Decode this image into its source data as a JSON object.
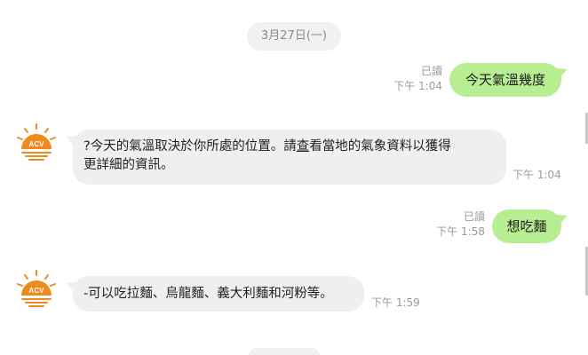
{
  "date_separator": "3月27日(一)",
  "brand": {
    "avatar_text": "ACV",
    "avatar_color": "#f08a1e"
  },
  "colors": {
    "outgoing_bubble": "#b8ee92",
    "incoming_bubble": "#efefef"
  },
  "messages": [
    {
      "direction": "out",
      "text": "今天氣溫幾度",
      "read": "已讀",
      "time": "下午 1:04"
    },
    {
      "direction": "in",
      "text_pre": "?今天的氣溫取決於你所處的位置。請",
      "text_underlined": "查",
      "text_post": "看當地的氣象資料以獲得",
      "text_line2": "更詳細的資訊。",
      "time": "下午 1:04"
    },
    {
      "direction": "out",
      "text": "想吃麵",
      "read": "已讀",
      "time": "下午 1:58"
    },
    {
      "direction": "in",
      "text": "-可以吃拉麵、烏龍麵、義大利麵和河粉等。",
      "time": "下午 1:59"
    }
  ]
}
